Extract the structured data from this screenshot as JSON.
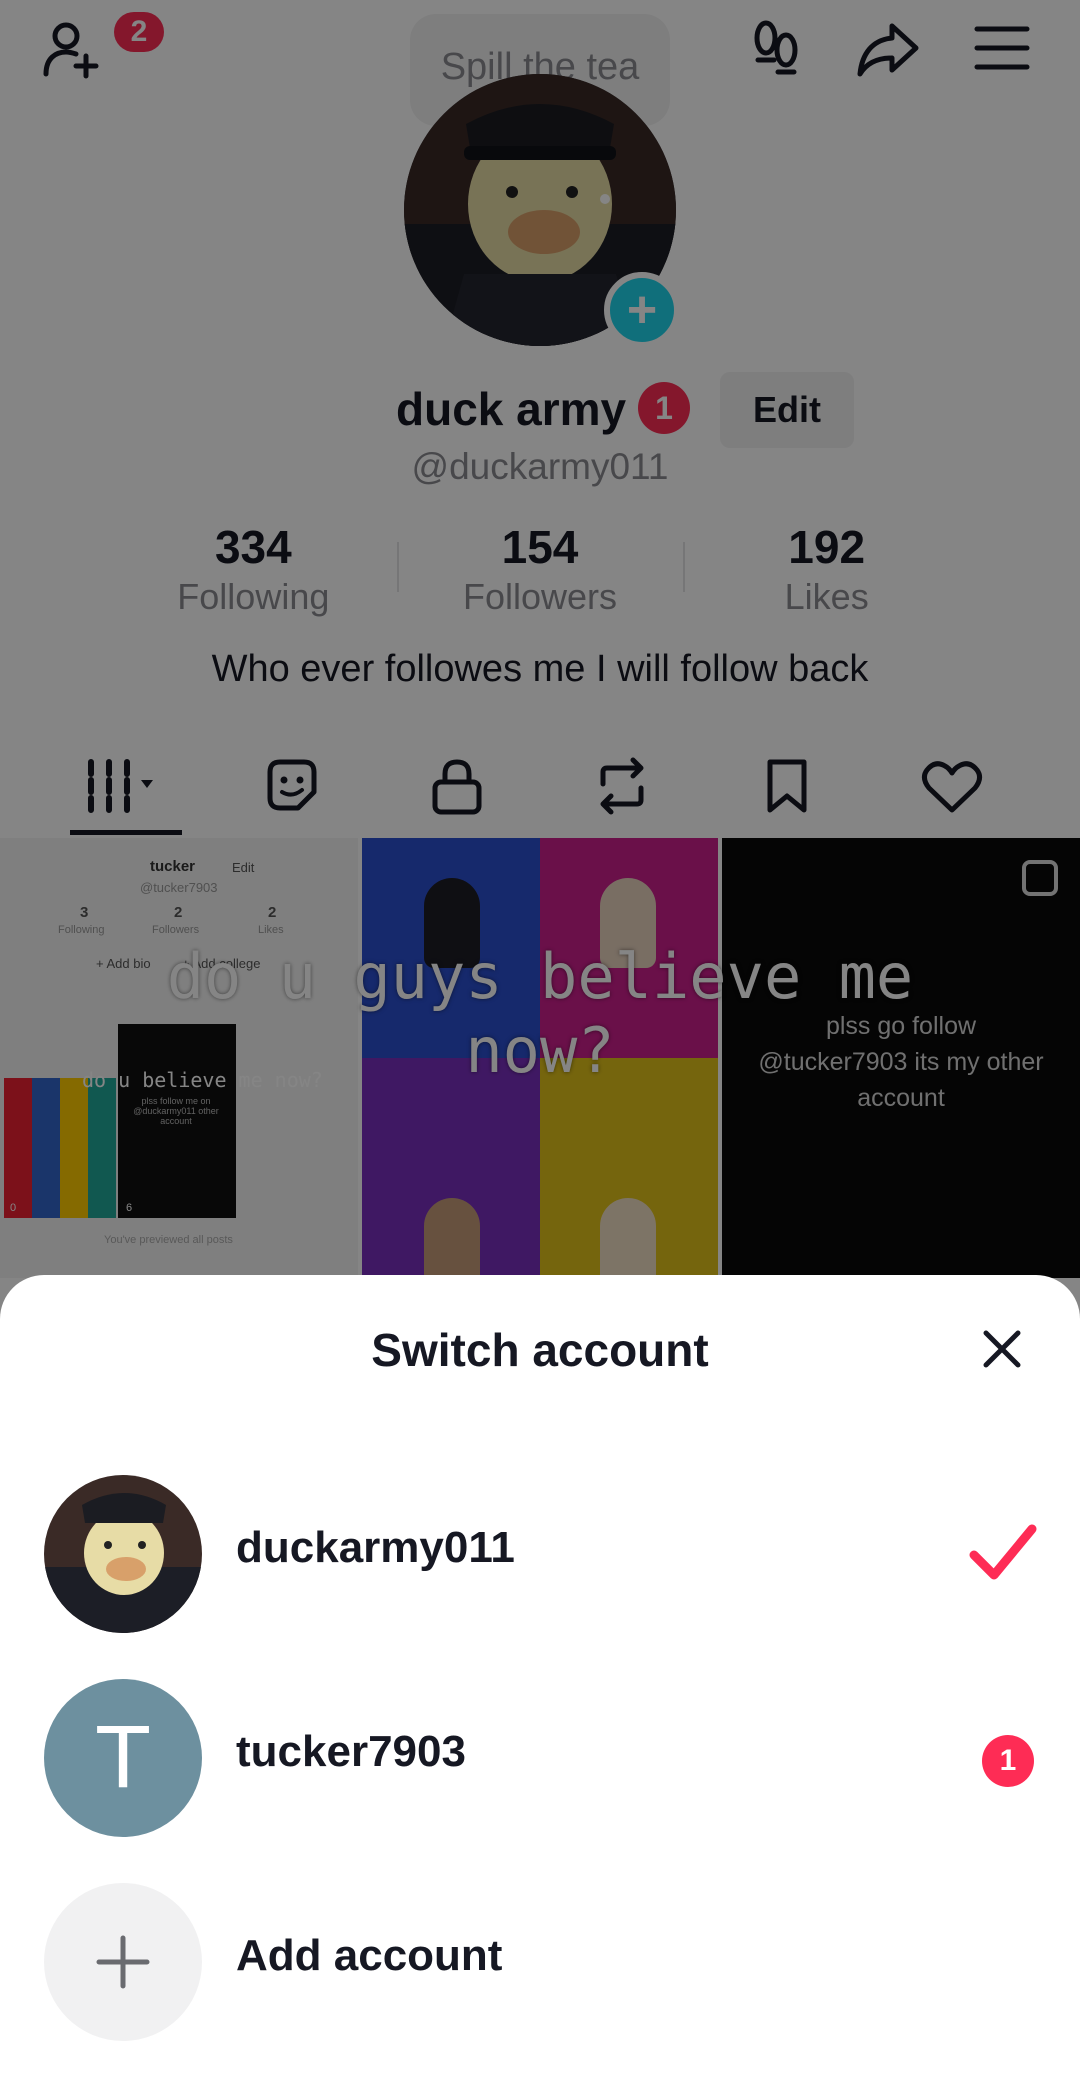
{
  "profile": {
    "notifications_count": "2",
    "bubble_text": "Spill the tea",
    "display_name": "duck army",
    "name_badge": "1",
    "edit_label": "Edit",
    "handle": "@duckarmy011",
    "stats": [
      {
        "num": "334",
        "label": "Following"
      },
      {
        "num": "154",
        "label": "Followers"
      },
      {
        "num": "192",
        "label": "Likes"
      }
    ],
    "bio": "Who ever followes me I will follow back"
  },
  "tabs": [
    "videos",
    "reposts-stickers",
    "private",
    "reposts",
    "favorites",
    "liked"
  ],
  "grid": {
    "overlay_text_line1": "do u guys believe me",
    "overlay_text_line2": "now?",
    "cell3_caption_1": "plss go follow",
    "cell3_caption_2": "@tucker7903 its my other",
    "cell3_caption_3": "account",
    "cell1_mini": {
      "name": "tucker",
      "edit": "Edit",
      "handle": "@tucker7903",
      "following": "3",
      "followers": "2",
      "likes": "2",
      "following_label": "Following",
      "followers_label": "Followers",
      "likes_label": "Likes",
      "add_bio": "+ Add bio",
      "add_college": "+ Add college",
      "thumb_text": "do u believe me now?",
      "thumb_caption": "plss follow me on @duckarmy011 other account",
      "previewed": "You've previewed all posts",
      "view0": "0",
      "view6": "6"
    }
  },
  "sheet": {
    "title": "Switch account",
    "accounts": [
      {
        "username": "duckarmy011",
        "selected": true
      },
      {
        "username": "tucker7903",
        "initial": "T",
        "badge": "1"
      },
      {
        "username": "Add account"
      }
    ]
  },
  "colors": {
    "accent": "#fe2c55",
    "avatar_plus": "#20d5ec",
    "avatar_t": "#6d909f"
  }
}
